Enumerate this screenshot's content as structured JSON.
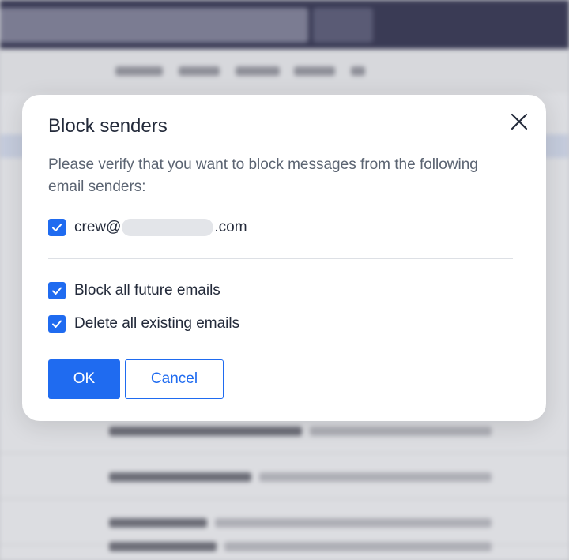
{
  "dialog": {
    "title": "Block senders",
    "message": "Please verify that you want to block messages from the following email senders:",
    "sender": {
      "prefix": "crew@",
      "suffix": ".com",
      "checked": true
    },
    "options": [
      {
        "label": "Block all future emails",
        "checked": true
      },
      {
        "label": "Delete all existing emails",
        "checked": true
      }
    ],
    "ok_label": "OK",
    "cancel_label": "Cancel"
  },
  "icons": {
    "close": "close-icon",
    "checkbox": "checkmark-icon"
  },
  "colors": {
    "accent": "#1f6bf0",
    "title_text": "#232a3a",
    "body_text": "#5b6472",
    "overlay": "#c9cacf"
  }
}
